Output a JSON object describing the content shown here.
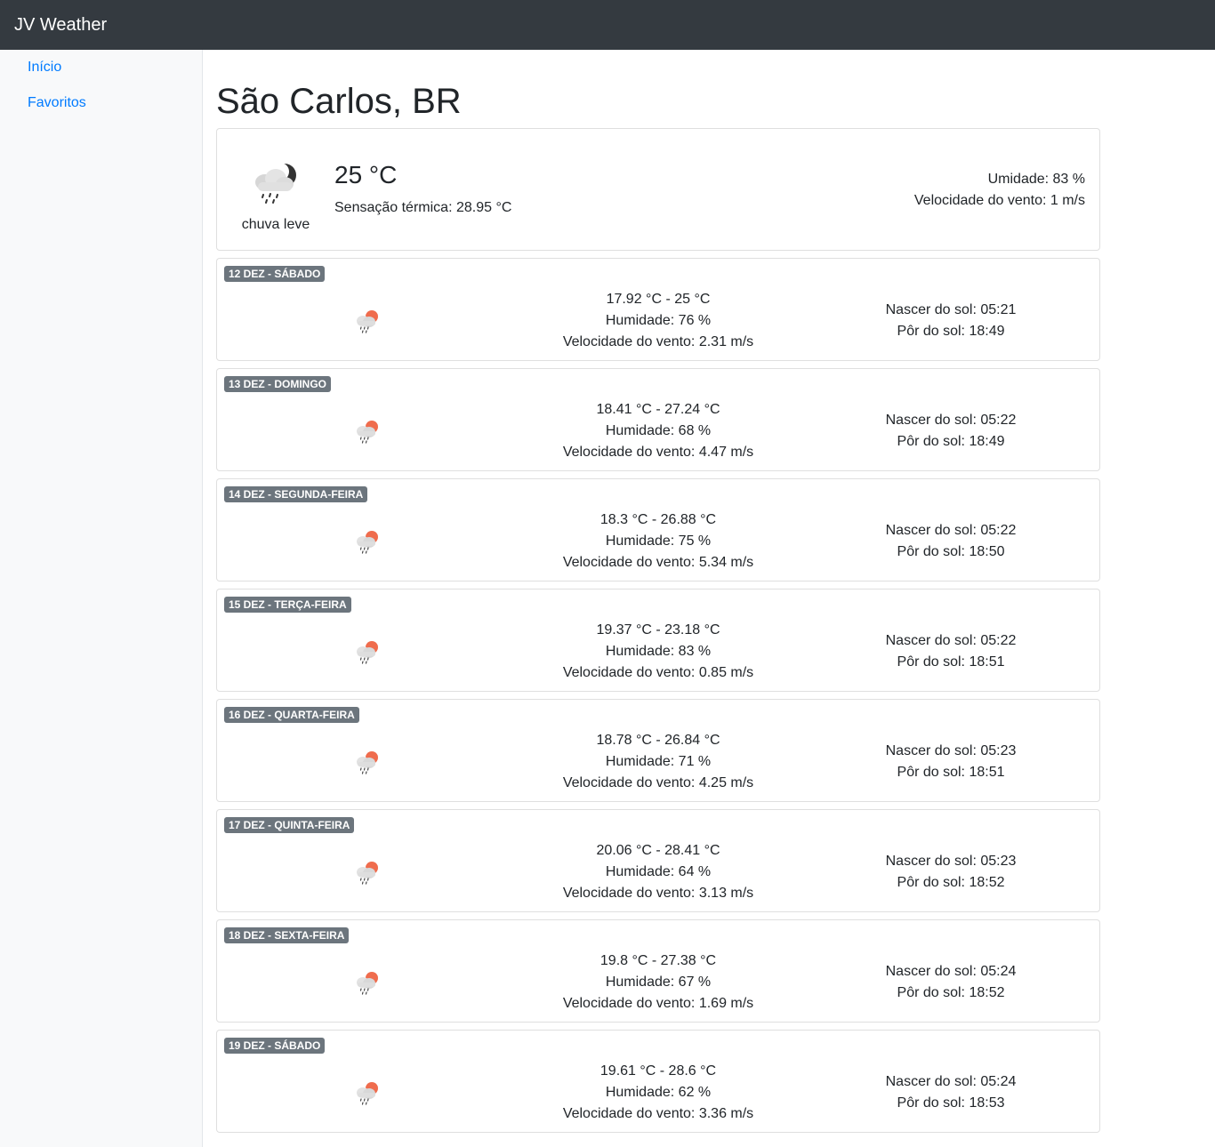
{
  "app": {
    "title": "JV Weather"
  },
  "sidebar": {
    "items": [
      {
        "label": "Início"
      },
      {
        "label": "Favoritos"
      }
    ]
  },
  "location": {
    "name": "São Carlos, BR"
  },
  "current": {
    "icon": "night-rain-cloud-icon",
    "description": "chuva leve",
    "temperature": "25 °C",
    "feels_like": "Sensação térmica: 28.95 °C",
    "humidity": "Umidade: 83 %",
    "wind": "Velocidade do vento: 1 m/s"
  },
  "forecast": [
    {
      "date": "12 DEZ - SÁBADO",
      "icon": "sun-rain-cloud-icon",
      "range": "17.92 °C - 25 °C",
      "humidity": "Humidade: 76 %",
      "wind": "Velocidade do vento: 2.31 m/s",
      "sunrise": "Nascer do sol: 05:21",
      "sunset": "Pôr do sol: 18:49"
    },
    {
      "date": "13 DEZ - DOMINGO",
      "icon": "sun-rain-cloud-icon",
      "range": "18.41 °C - 27.24 °C",
      "humidity": "Humidade: 68 %",
      "wind": "Velocidade do vento: 4.47 m/s",
      "sunrise": "Nascer do sol: 05:22",
      "sunset": "Pôr do sol: 18:49"
    },
    {
      "date": "14 DEZ - SEGUNDA-FEIRA",
      "icon": "sun-rain-cloud-icon",
      "range": "18.3 °C - 26.88 °C",
      "humidity": "Humidade: 75 %",
      "wind": "Velocidade do vento: 5.34 m/s",
      "sunrise": "Nascer do sol: 05:22",
      "sunset": "Pôr do sol: 18:50"
    },
    {
      "date": "15 DEZ - TERÇA-FEIRA",
      "icon": "sun-rain-cloud-icon",
      "range": "19.37 °C - 23.18 °C",
      "humidity": "Humidade: 83 %",
      "wind": "Velocidade do vento: 0.85 m/s",
      "sunrise": "Nascer do sol: 05:22",
      "sunset": "Pôr do sol: 18:51"
    },
    {
      "date": "16 DEZ - QUARTA-FEIRA",
      "icon": "sun-rain-cloud-icon",
      "range": "18.78 °C - 26.84 °C",
      "humidity": "Humidade: 71 %",
      "wind": "Velocidade do vento: 4.25 m/s",
      "sunrise": "Nascer do sol: 05:23",
      "sunset": "Pôr do sol: 18:51"
    },
    {
      "date": "17 DEZ - QUINTA-FEIRA",
      "icon": "sun-rain-cloud-icon",
      "range": "20.06 °C - 28.41 °C",
      "humidity": "Humidade: 64 %",
      "wind": "Velocidade do vento: 3.13 m/s",
      "sunrise": "Nascer do sol: 05:23",
      "sunset": "Pôr do sol: 18:52"
    },
    {
      "date": "18 DEZ - SEXTA-FEIRA",
      "icon": "sun-rain-cloud-icon",
      "range": "19.8 °C - 27.38 °C",
      "humidity": "Humidade: 67 %",
      "wind": "Velocidade do vento: 1.69 m/s",
      "sunrise": "Nascer do sol: 05:24",
      "sunset": "Pôr do sol: 18:52"
    },
    {
      "date": "19 DEZ - SÁBADO",
      "icon": "sun-rain-cloud-icon",
      "range": "19.61 °C - 28.6 °C",
      "humidity": "Humidade: 62 %",
      "wind": "Velocidade do vento: 3.36 m/s",
      "sunrise": "Nascer do sol: 05:24",
      "sunset": "Pôr do sol: 18:53"
    }
  ]
}
